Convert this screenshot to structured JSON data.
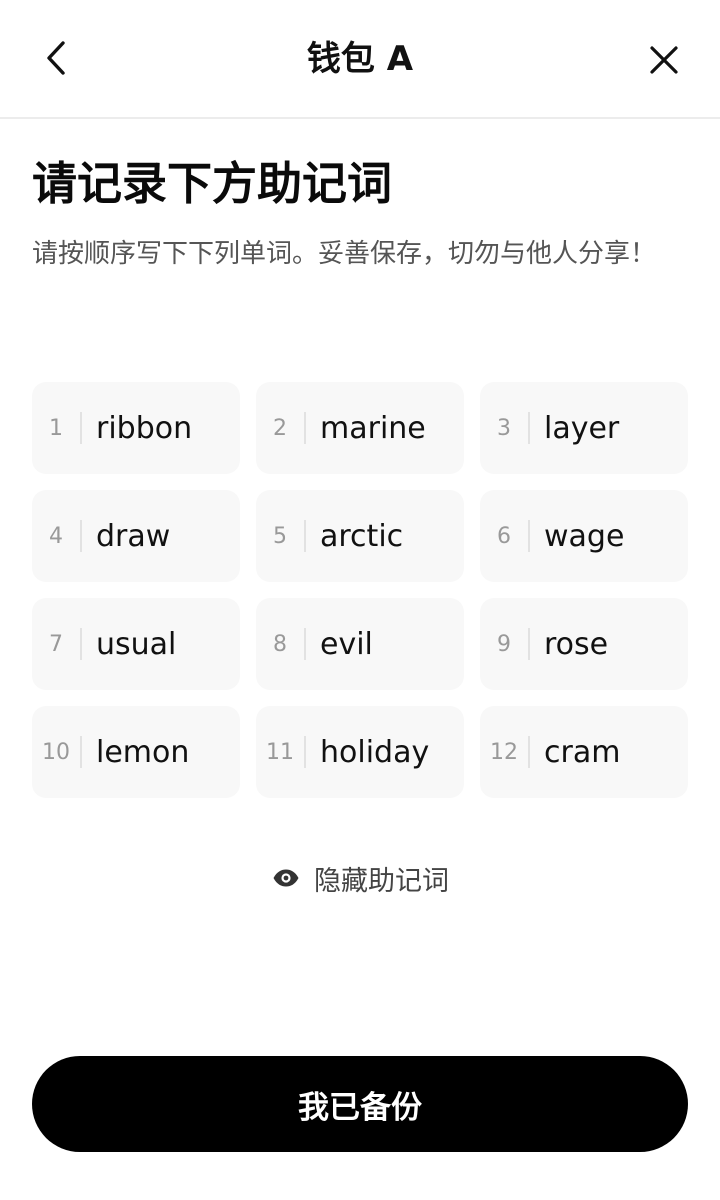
{
  "header": {
    "title": "钱包 A",
    "back_icon": "chevron-left-icon",
    "close_icon": "close-icon"
  },
  "main": {
    "title": "请记录下方助记词",
    "subtitle": "请按顺序写下下列单词。妥善保存，切勿与他人分享！"
  },
  "mnemonic": [
    {
      "index": "1",
      "word": "ribbon"
    },
    {
      "index": "2",
      "word": "marine"
    },
    {
      "index": "3",
      "word": "layer"
    },
    {
      "index": "4",
      "word": "draw"
    },
    {
      "index": "5",
      "word": "arctic"
    },
    {
      "index": "6",
      "word": "wage"
    },
    {
      "index": "7",
      "word": "usual"
    },
    {
      "index": "8",
      "word": "evil"
    },
    {
      "index": "9",
      "word": "rose"
    },
    {
      "index": "10",
      "word": "lemon"
    },
    {
      "index": "11",
      "word": "holiday"
    },
    {
      "index": "12",
      "word": "cram"
    }
  ],
  "toggle": {
    "label": "隐藏助记词",
    "icon": "eye-icon"
  },
  "footer": {
    "confirm_label": "我已备份"
  },
  "colors": {
    "primary": "#000000",
    "cell_bg": "#f8f8f8",
    "muted_text": "#999999"
  }
}
